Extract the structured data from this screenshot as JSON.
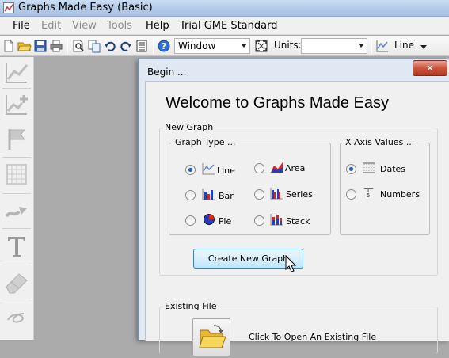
{
  "window": {
    "title": "Graphs Made Easy (Basic)"
  },
  "menu": [
    "File",
    "Edit",
    "View",
    "Tools",
    "Help",
    "Trial GME Standard"
  ],
  "toolbar": {
    "view_select": "Window",
    "units_label": "Units:",
    "units_value": "",
    "graph_type_select": "Line"
  },
  "dialog": {
    "title": "Begin ...",
    "close_symbol": "✕",
    "welcome": "Welcome to Graphs Made Easy",
    "new_graph": {
      "legend": "New Graph",
      "graph_type": {
        "legend": "Graph Type ...",
        "options": [
          {
            "label": "Line",
            "icon": "line-chart-icon",
            "checked": true
          },
          {
            "label": "Area",
            "icon": "area-chart-icon",
            "checked": false
          },
          {
            "label": "Bar",
            "icon": "bar-chart-icon",
            "checked": false
          },
          {
            "label": "Series",
            "icon": "series-chart-icon",
            "checked": false
          },
          {
            "label": "Pie",
            "icon": "pie-chart-icon",
            "checked": false
          },
          {
            "label": "Stack",
            "icon": "stack-chart-icon",
            "checked": false
          }
        ]
      },
      "x_axis": {
        "legend": "X Axis Values ...",
        "options": [
          {
            "label": "Dates",
            "icon": "calendar-icon",
            "checked": true
          },
          {
            "label": "Numbers",
            "icon": "number-axis-icon",
            "glyph": "5",
            "checked": false
          }
        ]
      },
      "create_button": "Create New Graph"
    },
    "existing_file": {
      "legend": "Existing File",
      "open_label": "Click To Open An Existing File"
    }
  },
  "colors": {
    "accent_blue": "#2a5fb0",
    "close_red": "#c9553c",
    "chart_red": "#e02020",
    "chart_blue": "#2040c0"
  }
}
